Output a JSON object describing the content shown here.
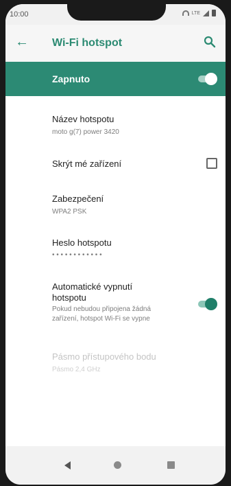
{
  "status_bar": {
    "time": "10:00",
    "network": "LTE"
  },
  "app_bar": {
    "title": "Wi-Fi hotspot",
    "back_icon": "arrow-back-icon",
    "search_icon": "search-icon"
  },
  "master_switch": {
    "label": "Zapnuto",
    "checked": true
  },
  "settings": [
    {
      "title": "Název hotspotu",
      "subtitle": "moto g(7) power 3420"
    },
    {
      "title": "Skrýt mé zařízení",
      "checkbox_checked": false
    },
    {
      "title": "Zabezpečení",
      "subtitle": "WPA2 PSK"
    },
    {
      "title": "Heslo hotspotu",
      "subtitle": "• • • • • • • • • • • •"
    },
    {
      "title_line1": "Automatické vypnutí",
      "title_line2": "hotspotu",
      "subtitle_line1": "Pokud nebudou připojena žádná",
      "subtitle_line2": "zařízení, hotspot Wi-Fi se vypne",
      "checked": true
    },
    {
      "title": "Pásmo přístupového bodu",
      "subtitle": "Pásmo 2,4 GHz",
      "disabled": true
    }
  ],
  "colors": {
    "accent": "#2c8a74",
    "accent_text": "#2b8a72"
  },
  "nav_bar": {
    "back": "nav-back-icon",
    "home": "nav-home-icon",
    "recents": "nav-recents-icon"
  }
}
